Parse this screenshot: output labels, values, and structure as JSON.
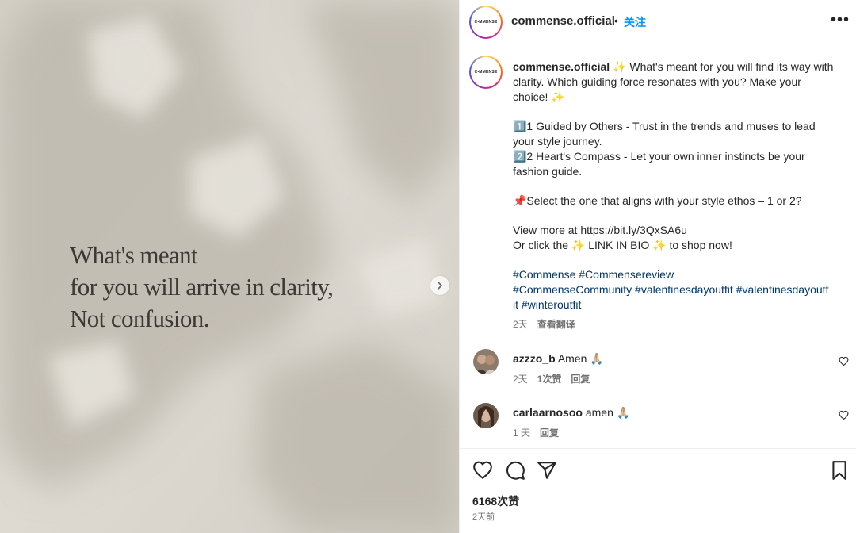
{
  "post_image": {
    "quote_lines": [
      "What's meant",
      "for you will arrive in clarity,",
      "Not confusion."
    ]
  },
  "header": {
    "username": "commense.official",
    "separator": "•",
    "follow_label": "关注",
    "more_label": "•••",
    "avatar_logo_text": "C•MMENSE"
  },
  "caption": {
    "username": "commense.official",
    "lines": [
      "✨ What's meant for you will find its way with",
      "clarity. Which guiding force resonates with you? Make your",
      "choice! ✨"
    ],
    "option1_line1": "1️⃣1 Guided by Others - Trust in the trends and muses to lead",
    "option1_line2": "your style journey.",
    "option2_line1": "2️⃣2 Heart's Compass - Let your own inner instincts be your",
    "option2_line2": "fashion guide.",
    "select_line": "📌Select the one that aligns with your style ethos – 1 or 2?",
    "view_more_line": "View more at https://bit.ly/3QxSA6u",
    "link_line": "Or click the ✨ LINK IN BIO ✨ to shop now!",
    "hashtags_line1": "#Commense #Commensereview",
    "hashtags_line2": "#CommenseCommunity #valentinesdayoutfit #valentinesdayoutf",
    "hashtags_line3": "it #winteroutfit",
    "time": "2天",
    "translate_label": "查看翻译"
  },
  "comments": [
    {
      "username": "azzzo_b",
      "text": "Amen 🙏🏼",
      "time": "2天",
      "likes": "1次赞",
      "reply": "回复"
    },
    {
      "username": "carlaarnosoo",
      "text": "amen 🙏🏼",
      "time": "1 天",
      "reply": "回复"
    }
  ],
  "footer": {
    "likes_count": "6168次赞",
    "posted_ago": "2天前"
  }
}
